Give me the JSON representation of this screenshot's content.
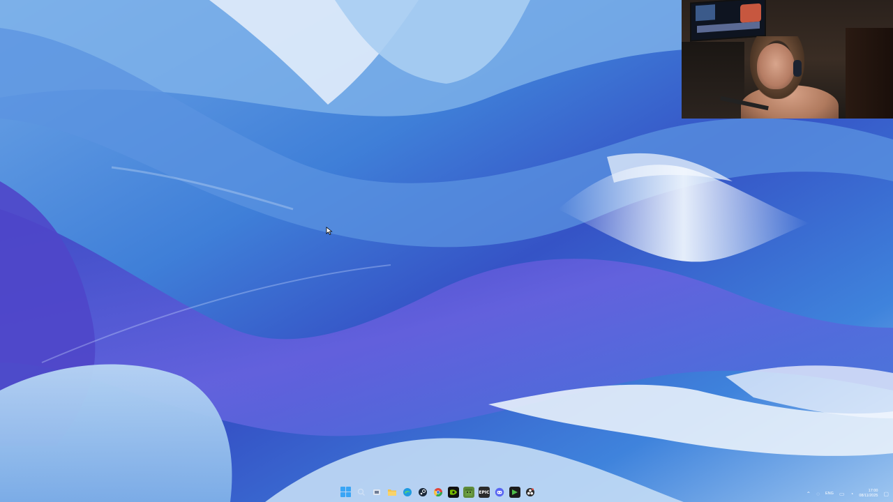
{
  "desktop": {
    "wallpaper_name": "wallpaper",
    "colors": {
      "deep_blue": "#2f5fcf",
      "violet": "#5a52d6",
      "light_blue": "#8fc2f0",
      "highlight": "#e8f1fb"
    }
  },
  "webcam": {
    "label": "webcam-overlay"
  },
  "taskbar": {
    "icons": [
      {
        "name": "start-icon",
        "glyph": ""
      },
      {
        "name": "search-icon",
        "glyph": "⚲",
        "color": "#9fb8d6"
      },
      {
        "name": "task-view-icon",
        "glyph": "▣",
        "color": "#7a8aa6"
      },
      {
        "name": "file-explorer-icon",
        "glyph": "▬",
        "color": "#f2c14e"
      },
      {
        "name": "edge-icon",
        "glyph": "◐",
        "color": "#1f9be0"
      },
      {
        "name": "steam-icon",
        "glyph": "⚙",
        "color": "#1b2838"
      },
      {
        "name": "chrome-icon",
        "glyph": "◉",
        "color": "#e0463a"
      },
      {
        "name": "nvidia-icon",
        "glyph": "◥",
        "color": "#3c8c1f"
      },
      {
        "name": "minecraft-icon",
        "glyph": "▦",
        "color": "#5f8c3a"
      },
      {
        "name": "epic-games-icon",
        "glyph": "E",
        "color": "#2b2b2b"
      },
      {
        "name": "discord-icon",
        "glyph": "☺",
        "color": "#5865f2"
      },
      {
        "name": "terminal-icon",
        "glyph": "▶",
        "color": "#1e6b2c"
      },
      {
        "name": "obs-icon",
        "glyph": "●",
        "color": "#2a2a2a"
      }
    ],
    "tray": {
      "language": "ENG",
      "time": "17:00",
      "date": "08/11/2025"
    }
  }
}
